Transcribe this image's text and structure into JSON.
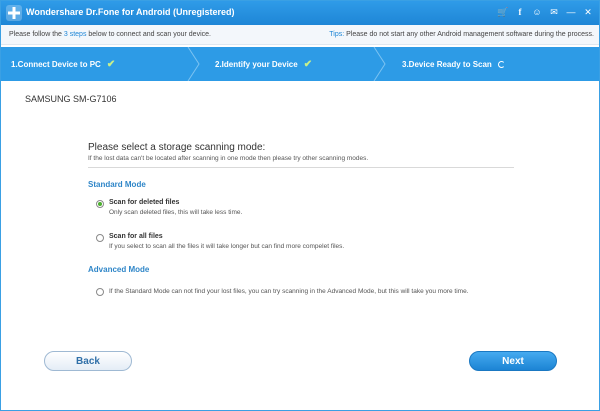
{
  "window": {
    "title": "Wondershare Dr.Fone for Android (Unregistered)",
    "titlebar_icons": [
      "cart-icon",
      "facebook-icon",
      "feedback-icon",
      "message-icon",
      "minimize-icon",
      "close-icon"
    ],
    "titlebar_glyphs": {
      "cart": "🛒",
      "facebook": "f",
      "feedback": "☺",
      "message": "✉",
      "minimize": "—",
      "close": "✕"
    }
  },
  "instructions": {
    "prefix": "Please follow the ",
    "link": "3 steps",
    "suffix": " below to connect and scan your device.",
    "tips_label": "Tips:",
    "tips_text": " Please do not start any other Android management software during the process."
  },
  "steps": [
    {
      "label": "1.Connect Device to PC",
      "status": "done"
    },
    {
      "label": "2.Identify your Device",
      "status": "done"
    },
    {
      "label": "3.Device Ready to Scan",
      "status": "loading"
    }
  ],
  "device": {
    "name": "SAMSUNG SM-G7106"
  },
  "scan": {
    "heading": "Please select a storage scanning mode:",
    "subheading": "If the lost data can't be located after scanning in one mode then please try other scanning modes.",
    "standard_title": "Standard Mode",
    "advanced_title": "Advanced Mode",
    "options": [
      {
        "title": "Scan for deleted files",
        "desc": "Only scan deleted files, this will take less time.",
        "selected": true
      },
      {
        "title": "Scan for all files",
        "desc": "If you select to scan all the files it will take longer but can find more compelet files.",
        "selected": false
      },
      {
        "desc": "If the Standard Mode can not find your lost files, you can try scanning in the Advanced Mode, but this will take you more time.",
        "selected": false
      }
    ]
  },
  "buttons": {
    "back": "Back",
    "next": "Next"
  },
  "colors": {
    "accent": "#2d9be6",
    "check": "#c8f08a",
    "section": "#2f86c8",
    "radio_selected": "#4caf2f"
  }
}
